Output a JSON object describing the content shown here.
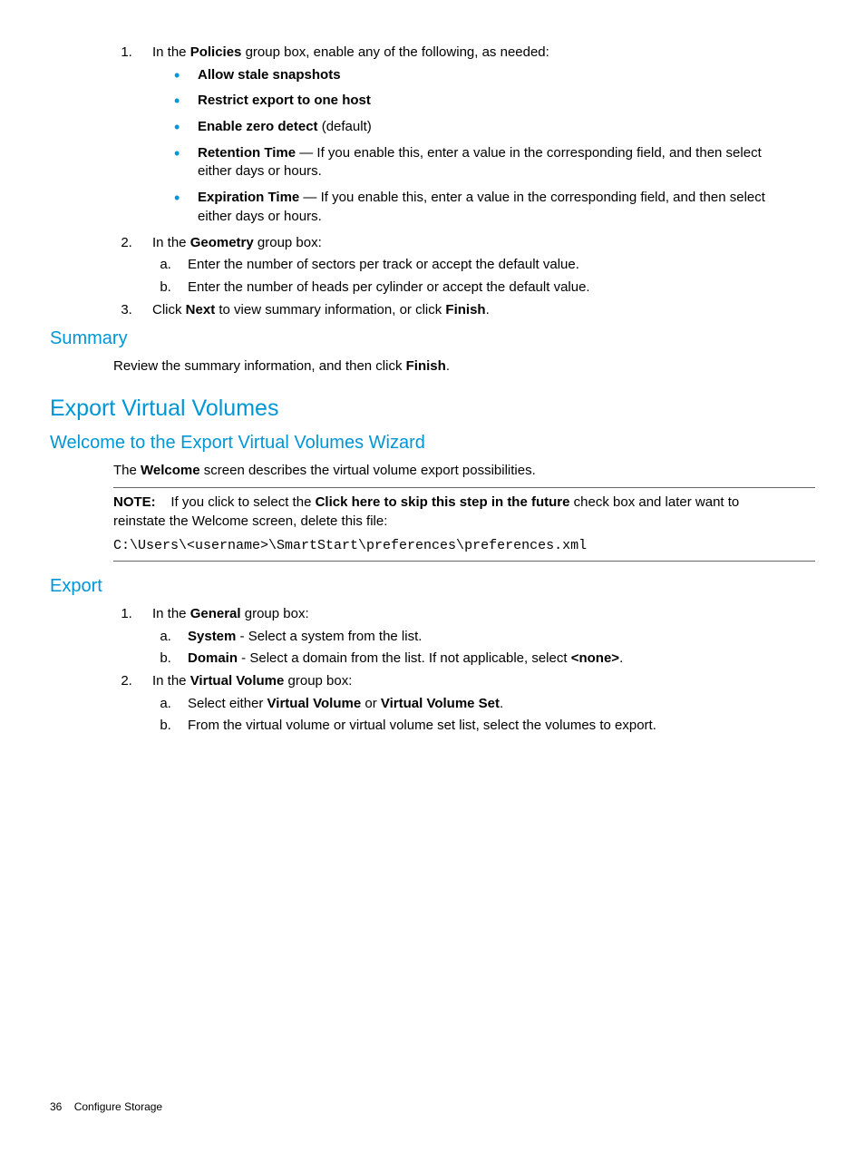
{
  "list1": {
    "item1": {
      "prefix": "In the ",
      "bold": "Policies",
      "suffix": " group box, enable any of the following, as needed:"
    },
    "bullets": {
      "b1": "Allow stale snapshots",
      "b2": "Restrict export to one host",
      "b3_bold": "Enable zero detect",
      "b3_suffix": " (default)",
      "b4_bold": "Retention Time",
      "b4_suffix": " — If you enable this, enter a value in the corresponding field, and then select either days or hours.",
      "b5_bold": "Expiration Time",
      "b5_suffix": " — If you enable this, enter a value in the corresponding field, and then select either days or hours."
    },
    "item2": {
      "prefix": "In the ",
      "bold": "Geometry",
      "suffix": " group box:"
    },
    "alpha2": {
      "a": "Enter the number of sectors per track or accept the default value.",
      "b": "Enter the number of heads per cylinder or accept the default value."
    },
    "item3": {
      "p1": "Click ",
      "b1": "Next",
      "p2": " to view summary information, or click ",
      "b2": "Finish",
      "p3": "."
    }
  },
  "summary": {
    "heading": "Summary",
    "text_p1": "Review the summary information, and then click ",
    "text_bold": "Finish",
    "text_p2": "."
  },
  "exportVV": {
    "heading": "Export Virtual Volumes"
  },
  "welcome": {
    "heading": "Welcome to the Export Virtual Volumes Wizard",
    "text_p1": "The ",
    "text_bold": "Welcome",
    "text_p2": " screen describes the virtual volume export possibilities."
  },
  "note": {
    "label": "NOTE:",
    "p1": "If you click to select the ",
    "bold": "Click here to skip this step in the future",
    "p2": " check box and later want to reinstate the Welcome screen, delete this file:",
    "code": "C:\\Users\\<username>\\SmartStart\\preferences\\preferences.xml"
  },
  "export": {
    "heading": "Export",
    "item1": {
      "prefix": "In the ",
      "bold": "General",
      "suffix": " group box:"
    },
    "alpha1": {
      "a_bold": "System",
      "a_suffix": " - Select a system from the list.",
      "b_bold": "Domain",
      "b_p1": " - Select a domain from the list. If not applicable, select ",
      "b_bold2": "<none>",
      "b_p2": "."
    },
    "item2": {
      "prefix": "In the ",
      "bold": "Virtual Volume",
      "suffix": " group box:"
    },
    "alpha2": {
      "a_p1": "Select either ",
      "a_b1": "Virtual Volume",
      "a_p2": " or ",
      "a_b2": "Virtual Volume Set",
      "a_p3": ".",
      "b": "From the virtual volume or virtual volume set list, select the volumes to export."
    }
  },
  "footer": {
    "page": "36",
    "section": "Configure Storage"
  }
}
